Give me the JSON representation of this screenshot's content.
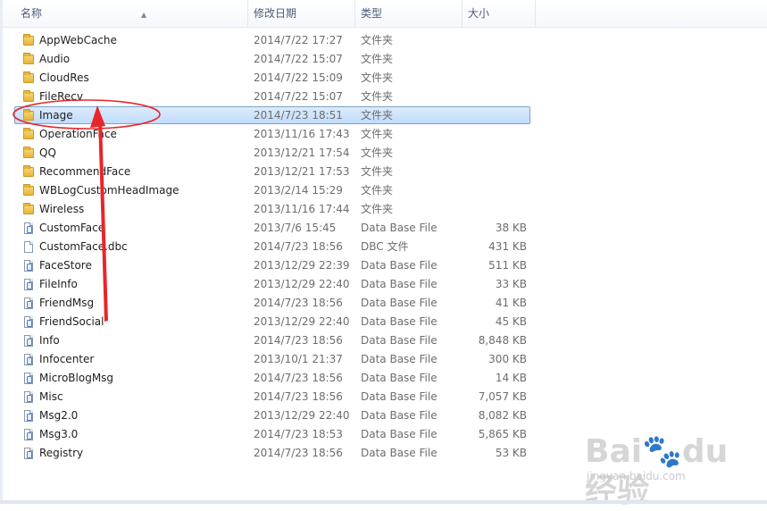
{
  "columns": {
    "name": "名称",
    "date": "修改日期",
    "type": "类型",
    "size": "大小"
  },
  "sort_arrow": "▲",
  "rows": [
    {
      "name": "AppWebCache",
      "date": "2014/7/22 17:27",
      "type": "文件夹",
      "size": "",
      "kind": "folder"
    },
    {
      "name": "Audio",
      "date": "2014/7/22 15:07",
      "type": "文件夹",
      "size": "",
      "kind": "folder"
    },
    {
      "name": "CloudRes",
      "date": "2014/7/22 15:09",
      "type": "文件夹",
      "size": "",
      "kind": "folder"
    },
    {
      "name": "FileRecv",
      "date": "2014/7/22 15:07",
      "type": "文件夹",
      "size": "",
      "kind": "folder"
    },
    {
      "name": "Image",
      "date": "2014/7/23 18:51",
      "type": "文件夹",
      "size": "",
      "kind": "folder",
      "selected": true
    },
    {
      "name": "OperationFace",
      "date": "2013/11/16 17:43",
      "type": "文件夹",
      "size": "",
      "kind": "folder"
    },
    {
      "name": "QQ",
      "date": "2013/12/21 17:54",
      "type": "文件夹",
      "size": "",
      "kind": "folder"
    },
    {
      "name": "RecommendFace",
      "date": "2013/12/21 17:53",
      "type": "文件夹",
      "size": "",
      "kind": "folder"
    },
    {
      "name": "WBLogCustomHeadImage",
      "date": "2013/2/14 15:29",
      "type": "文件夹",
      "size": "",
      "kind": "folder"
    },
    {
      "name": "Wireless",
      "date": "2013/11/16 17:44",
      "type": "文件夹",
      "size": "",
      "kind": "folder"
    },
    {
      "name": "CustomFace",
      "date": "2013/7/6 15:45",
      "type": "Data Base File",
      "size": "38 KB",
      "kind": "db"
    },
    {
      "name": "CustomFace.dbc",
      "date": "2014/7/23 18:56",
      "type": "DBC 文件",
      "size": "431 KB",
      "kind": "file"
    },
    {
      "name": "FaceStore",
      "date": "2013/12/29 22:39",
      "type": "Data Base File",
      "size": "511 KB",
      "kind": "db"
    },
    {
      "name": "FileInfo",
      "date": "2013/12/29 22:40",
      "type": "Data Base File",
      "size": "33 KB",
      "kind": "db"
    },
    {
      "name": "FriendMsg",
      "date": "2014/7/23 18:56",
      "type": "Data Base File",
      "size": "41 KB",
      "kind": "db"
    },
    {
      "name": "FriendSocial",
      "date": "2013/12/29 22:40",
      "type": "Data Base File",
      "size": "45 KB",
      "kind": "db"
    },
    {
      "name": "Info",
      "date": "2014/7/23 18:56",
      "type": "Data Base File",
      "size": "8,848 KB",
      "kind": "db"
    },
    {
      "name": "Infocenter",
      "date": "2013/10/1 21:37",
      "type": "Data Base File",
      "size": "300 KB",
      "kind": "db"
    },
    {
      "name": "MicroBlogMsg",
      "date": "2014/7/23 18:56",
      "type": "Data Base File",
      "size": "14 KB",
      "kind": "db"
    },
    {
      "name": "Misc",
      "date": "2014/7/23 18:56",
      "type": "Data Base File",
      "size": "7,057 KB",
      "kind": "db"
    },
    {
      "name": "Msg2.0",
      "date": "2013/12/29 22:40",
      "type": "Data Base File",
      "size": "8,082 KB",
      "kind": "db"
    },
    {
      "name": "Msg3.0",
      "date": "2014/7/23 18:53",
      "type": "Data Base File",
      "size": "5,865 KB",
      "kind": "db"
    },
    {
      "name": "Registry",
      "date": "2014/7/23 18:56",
      "type": "Data Base File",
      "size": "53 KB",
      "kind": "db"
    }
  ],
  "annotation": {
    "color": "#e8262a"
  },
  "watermark": {
    "logo": "Bai🐾du 经验",
    "url": "jingyan.baidu.com"
  },
  "icons": {
    "folder": "folder-icon",
    "file": "file-icon",
    "db": "database-file-icon"
  }
}
